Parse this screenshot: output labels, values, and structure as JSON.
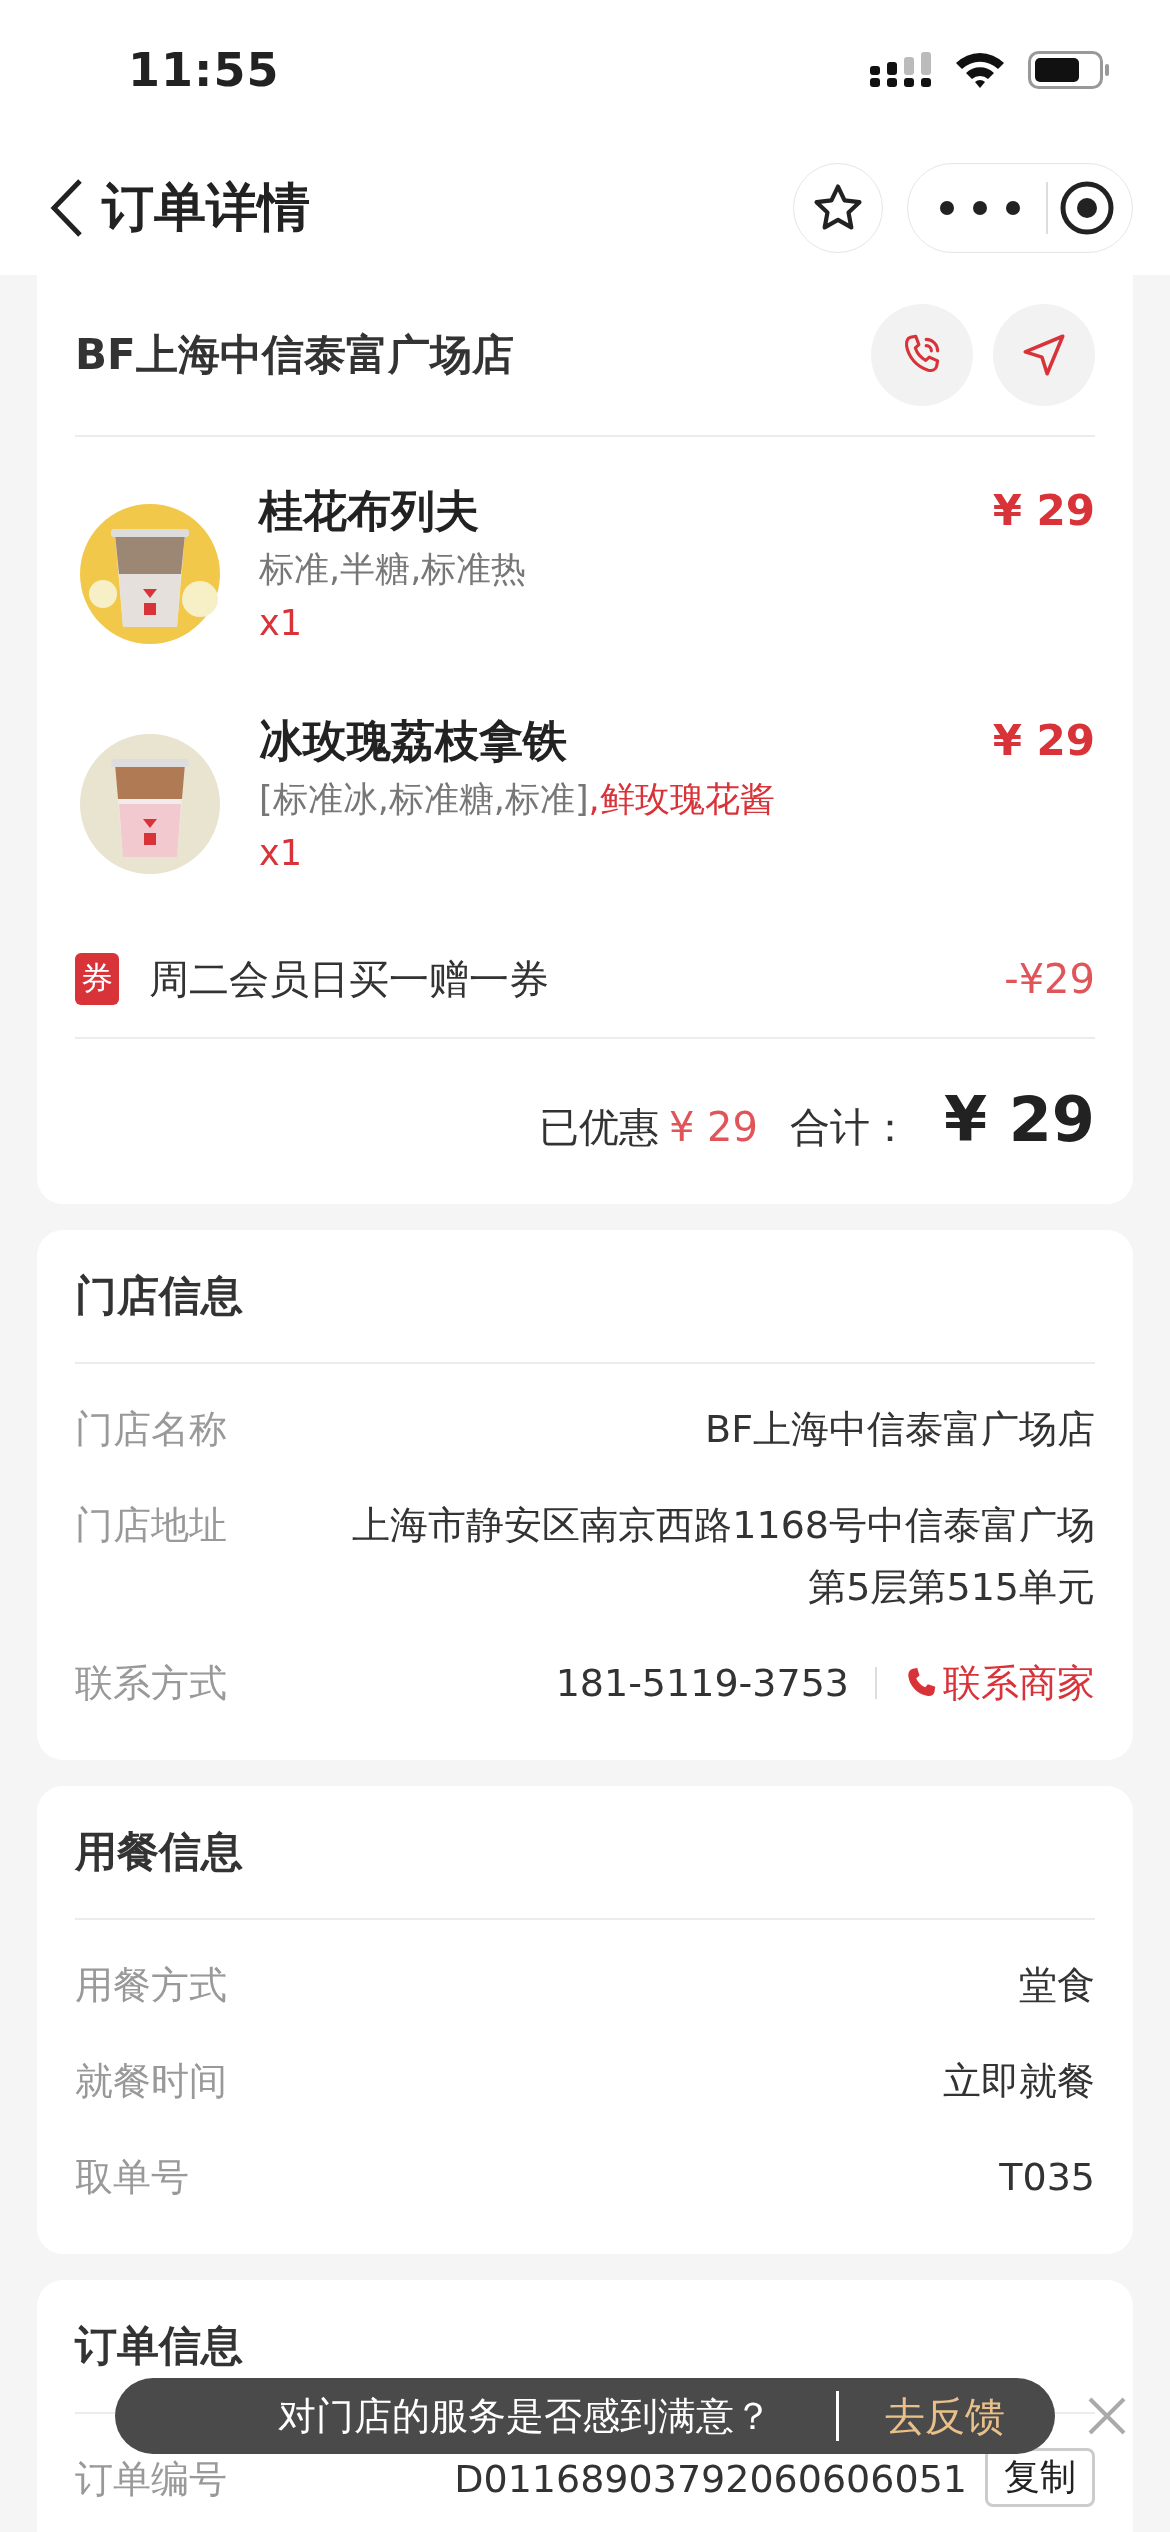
{
  "status_bar": {
    "time": "11:55"
  },
  "nav": {
    "title": "订单详情"
  },
  "order_card": {
    "store_name": "BF上海中信泰富广场店",
    "items": [
      {
        "name": "桂花布列夫",
        "spec": "标准,半糖,标准热",
        "quantity": "x1",
        "price": "¥ 29"
      },
      {
        "name": "冰玫瑰荔枝拿铁",
        "spec": "[标准冰,标准糖,标准]",
        "addon": ",鲜玫瑰花酱",
        "quantity": "x1",
        "price": "¥ 29"
      }
    ],
    "coupon": {
      "badge": "券",
      "label": "周二会员日买一赠一券",
      "amount": "-¥29"
    },
    "summary": {
      "discount_label": "已优惠",
      "discount": "¥ 29",
      "total_label": "合计：",
      "total": "¥ 29"
    }
  },
  "sections": [
    {
      "title": "门店信息",
      "rows": [
        {
          "label": "门店名称",
          "value": "BF上海中信泰富广场店"
        },
        {
          "label": "门店地址",
          "value": "上海市静安区南京西路1168号中信泰富广场第5层第515单元"
        },
        {
          "label": "联系方式",
          "value": "181-5119-3753",
          "action": "联系商家"
        }
      ]
    },
    {
      "title": "用餐信息",
      "rows": [
        {
          "label": "用餐方式",
          "value": "堂食"
        },
        {
          "label": "就餐时间",
          "value": "立即就餐"
        },
        {
          "label": "取单号",
          "value": "T035"
        }
      ]
    },
    {
      "title": "订单信息",
      "rows": [
        {
          "label": "订单编号",
          "value": "D01168903792060606051",
          "button": "复制"
        }
      ]
    }
  ],
  "toast": {
    "text": "对门店的服务是否感到满意？",
    "action": "去反馈"
  }
}
